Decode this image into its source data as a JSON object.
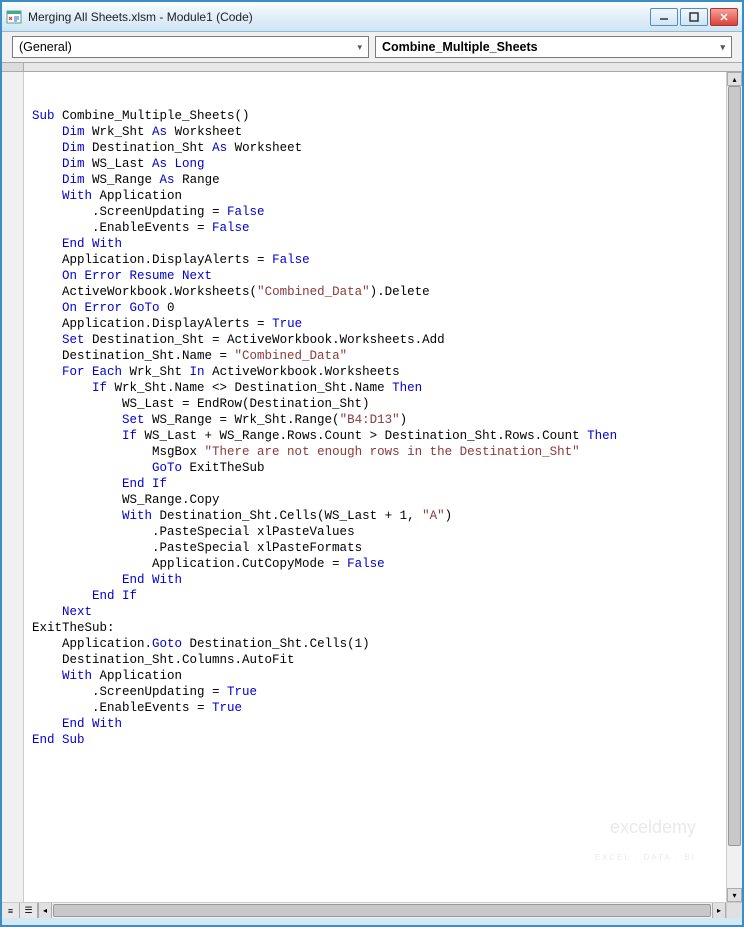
{
  "window": {
    "title": "Merging All Sheets.xlsm - Module1 (Code)"
  },
  "dropdowns": {
    "left": {
      "value": "(General)"
    },
    "right": {
      "value": "Combine_Multiple_Sheets"
    }
  },
  "watermark": {
    "brand": "exceldemy",
    "tagline": "EXCEL · DATA · BI"
  },
  "code": {
    "lines": [
      {
        "i": 0,
        "t": [
          {
            "c": "kw",
            "s": "Sub"
          },
          {
            "s": " Combine_Multiple_Sheets()"
          }
        ]
      },
      {
        "i": 1,
        "t": [
          {
            "c": "kw",
            "s": "Dim"
          },
          {
            "s": " Wrk_Sht "
          },
          {
            "c": "kw",
            "s": "As"
          },
          {
            "s": " Worksheet"
          }
        ]
      },
      {
        "i": 1,
        "t": [
          {
            "c": "kw",
            "s": "Dim"
          },
          {
            "s": " Destination_Sht "
          },
          {
            "c": "kw",
            "s": "As"
          },
          {
            "s": " Worksheet"
          }
        ]
      },
      {
        "i": 1,
        "t": [
          {
            "c": "kw",
            "s": "Dim"
          },
          {
            "s": " WS_Last "
          },
          {
            "c": "kw",
            "s": "As Long"
          }
        ]
      },
      {
        "i": 1,
        "t": [
          {
            "c": "kw",
            "s": "Dim"
          },
          {
            "s": " WS_Range "
          },
          {
            "c": "kw",
            "s": "As"
          },
          {
            "s": " Range"
          }
        ]
      },
      {
        "i": 0,
        "t": [
          {
            "s": ""
          }
        ]
      },
      {
        "i": 1,
        "t": [
          {
            "c": "kw",
            "s": "With"
          },
          {
            "s": " Application"
          }
        ]
      },
      {
        "i": 2,
        "t": [
          {
            "s": ".ScreenUpdating = "
          },
          {
            "c": "kw",
            "s": "False"
          }
        ]
      },
      {
        "i": 2,
        "t": [
          {
            "s": ".EnableEvents = "
          },
          {
            "c": "kw",
            "s": "False"
          }
        ]
      },
      {
        "i": 1,
        "t": [
          {
            "c": "kw",
            "s": "End With"
          }
        ]
      },
      {
        "i": 0,
        "t": [
          {
            "s": ""
          }
        ]
      },
      {
        "i": 1,
        "t": [
          {
            "s": "Application.DisplayAlerts = "
          },
          {
            "c": "kw",
            "s": "False"
          }
        ]
      },
      {
        "i": 1,
        "t": [
          {
            "c": "kw",
            "s": "On Error Resume Next"
          }
        ]
      },
      {
        "i": 1,
        "t": [
          {
            "s": "ActiveWorkbook.Worksheets("
          },
          {
            "c": "str",
            "s": "\"Combined_Data\""
          },
          {
            "s": ").Delete"
          }
        ]
      },
      {
        "i": 1,
        "t": [
          {
            "c": "kw",
            "s": "On Error GoTo"
          },
          {
            "s": " 0"
          }
        ]
      },
      {
        "i": 1,
        "t": [
          {
            "s": "Application.DisplayAlerts = "
          },
          {
            "c": "kw",
            "s": "True"
          }
        ]
      },
      {
        "i": 0,
        "t": [
          {
            "s": ""
          }
        ]
      },
      {
        "i": 1,
        "t": [
          {
            "c": "kw",
            "s": "Set"
          },
          {
            "s": " Destination_Sht = ActiveWorkbook.Worksheets.Add"
          }
        ]
      },
      {
        "i": 1,
        "t": [
          {
            "s": "Destination_Sht.Name = "
          },
          {
            "c": "str",
            "s": "\"Combined_Data\""
          }
        ]
      },
      {
        "i": 0,
        "t": [
          {
            "s": ""
          }
        ]
      },
      {
        "i": 1,
        "t": [
          {
            "c": "kw",
            "s": "For Each"
          },
          {
            "s": " Wrk_Sht "
          },
          {
            "c": "kw",
            "s": "In"
          },
          {
            "s": " ActiveWorkbook.Worksheets"
          }
        ]
      },
      {
        "i": 2,
        "t": [
          {
            "c": "kw",
            "s": "If"
          },
          {
            "s": " Wrk_Sht.Name <> Destination_Sht.Name "
          },
          {
            "c": "kw",
            "s": "Then"
          }
        ]
      },
      {
        "i": 0,
        "t": [
          {
            "s": ""
          }
        ]
      },
      {
        "i": 3,
        "t": [
          {
            "s": "WS_Last = EndRow(Destination_Sht)"
          }
        ]
      },
      {
        "i": 0,
        "t": [
          {
            "s": ""
          }
        ]
      },
      {
        "i": 3,
        "t": [
          {
            "c": "kw",
            "s": "Set"
          },
          {
            "s": " WS_Range = Wrk_Sht.Range("
          },
          {
            "c": "str",
            "s": "\"B4:D13\""
          },
          {
            "s": ")"
          }
        ]
      },
      {
        "i": 0,
        "t": [
          {
            "s": ""
          }
        ]
      },
      {
        "i": 3,
        "t": [
          {
            "c": "kw",
            "s": "If"
          },
          {
            "s": " WS_Last + WS_Range.Rows.Count > Destination_Sht.Rows.Count "
          },
          {
            "c": "kw",
            "s": "Then"
          }
        ]
      },
      {
        "i": 4,
        "t": [
          {
            "s": "MsgBox "
          },
          {
            "c": "str",
            "s": "\"There are not enough rows in the Destination_Sht\""
          }
        ]
      },
      {
        "i": 4,
        "t": [
          {
            "c": "kw",
            "s": "GoTo"
          },
          {
            "s": " ExitTheSub"
          }
        ]
      },
      {
        "i": 3,
        "t": [
          {
            "c": "kw",
            "s": "End If"
          }
        ]
      },
      {
        "i": 0,
        "t": [
          {
            "s": ""
          }
        ]
      },
      {
        "i": 3,
        "t": [
          {
            "s": "WS_Range.Copy"
          }
        ]
      },
      {
        "i": 3,
        "t": [
          {
            "c": "kw",
            "s": "With"
          },
          {
            "s": " Destination_Sht.Cells(WS_Last + 1, "
          },
          {
            "c": "str",
            "s": "\"A\""
          },
          {
            "s": ")"
          }
        ]
      },
      {
        "i": 4,
        "t": [
          {
            "s": ".PasteSpecial xlPasteValues"
          }
        ]
      },
      {
        "i": 4,
        "t": [
          {
            "s": ".PasteSpecial xlPasteFormats"
          }
        ]
      },
      {
        "i": 4,
        "t": [
          {
            "s": "Application.CutCopyMode = "
          },
          {
            "c": "kw",
            "s": "False"
          }
        ]
      },
      {
        "i": 3,
        "t": [
          {
            "c": "kw",
            "s": "End With"
          }
        ]
      },
      {
        "i": 0,
        "t": [
          {
            "s": ""
          }
        ]
      },
      {
        "i": 2,
        "t": [
          {
            "c": "kw",
            "s": "End If"
          }
        ]
      },
      {
        "i": 1,
        "t": [
          {
            "c": "kw",
            "s": "Next"
          }
        ]
      },
      {
        "i": 0,
        "t": [
          {
            "s": ""
          }
        ]
      },
      {
        "i": 0,
        "t": [
          {
            "s": "ExitTheSub:"
          }
        ]
      },
      {
        "i": 0,
        "t": [
          {
            "s": ""
          }
        ]
      },
      {
        "i": 1,
        "t": [
          {
            "s": "Application."
          },
          {
            "c": "kw",
            "s": "Goto"
          },
          {
            "s": " Destination_Sht.Cells(1)"
          }
        ]
      },
      {
        "i": 1,
        "t": [
          {
            "s": "Destination_Sht.Columns.AutoFit"
          }
        ]
      },
      {
        "i": 0,
        "t": [
          {
            "s": ""
          }
        ]
      },
      {
        "i": 1,
        "t": [
          {
            "c": "kw",
            "s": "With"
          },
          {
            "s": " Application"
          }
        ]
      },
      {
        "i": 2,
        "t": [
          {
            "s": ".ScreenUpdating = "
          },
          {
            "c": "kw",
            "s": "True"
          }
        ]
      },
      {
        "i": 2,
        "t": [
          {
            "s": ".EnableEvents = "
          },
          {
            "c": "kw",
            "s": "True"
          }
        ]
      },
      {
        "i": 1,
        "t": [
          {
            "c": "kw",
            "s": "End With"
          }
        ]
      },
      {
        "i": 0,
        "t": [
          {
            "c": "kw",
            "s": "End Sub"
          }
        ]
      }
    ]
  }
}
